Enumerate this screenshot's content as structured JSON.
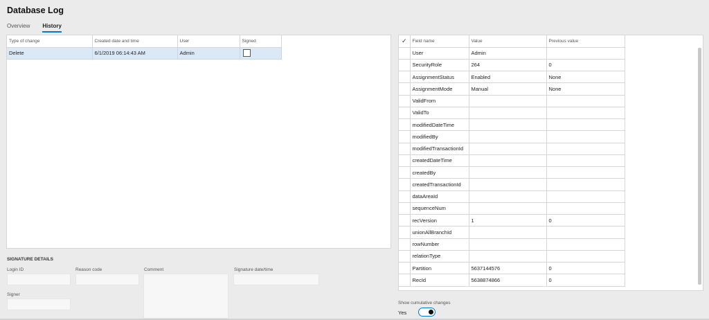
{
  "page": {
    "title": "Database Log"
  },
  "tabs": [
    {
      "label": "Overview",
      "active": false
    },
    {
      "label": "History",
      "active": true
    }
  ],
  "history_grid": {
    "columns": [
      "Type of change",
      "Created date and time",
      "User",
      "Signed"
    ],
    "rows": [
      {
        "type": "Delete",
        "created": "6/1/2019 06:14:43 AM",
        "user": "Admin",
        "signed": false
      }
    ]
  },
  "signature": {
    "title": "SIGNATURE DETAILS",
    "login_id_label": "Login ID",
    "reason_code_label": "Reason code",
    "comment_label": "Comment",
    "signature_datetime_label": "Signature date/time",
    "signer_label": "Signer"
  },
  "field_grid": {
    "check_header": "✓",
    "columns": [
      "Field name",
      "Value",
      "Previous value"
    ],
    "rows": [
      {
        "field": "User",
        "value": "Admin",
        "previous": ""
      },
      {
        "field": "SecurityRole",
        "value": "264",
        "previous": "0"
      },
      {
        "field": "AssignmentStatus",
        "value": "Enabled",
        "previous": "None"
      },
      {
        "field": "AssignmentMode",
        "value": "Manual",
        "previous": "None"
      },
      {
        "field": "ValidFrom",
        "value": "",
        "previous": ""
      },
      {
        "field": "ValidTo",
        "value": "",
        "previous": ""
      },
      {
        "field": "modifiedDateTime",
        "value": "",
        "previous": ""
      },
      {
        "field": "modifiedBy",
        "value": "",
        "previous": ""
      },
      {
        "field": "modifiedTransactionId",
        "value": "",
        "previous": ""
      },
      {
        "field": "createdDateTime",
        "value": "",
        "previous": ""
      },
      {
        "field": "createdBy",
        "value": "",
        "previous": ""
      },
      {
        "field": "createdTransactionId",
        "value": "",
        "previous": ""
      },
      {
        "field": "dataAreaId",
        "value": "",
        "previous": ""
      },
      {
        "field": "sequenceNum",
        "value": "",
        "previous": ""
      },
      {
        "field": "recVersion",
        "value": "1",
        "previous": "0"
      },
      {
        "field": "unionAllBranchId",
        "value": "",
        "previous": ""
      },
      {
        "field": "rowNumber",
        "value": "",
        "previous": ""
      },
      {
        "field": "relationType",
        "value": "",
        "previous": ""
      },
      {
        "field": "Partition",
        "value": "5637144576",
        "previous": "0"
      },
      {
        "field": "RecId",
        "value": "5638874866",
        "previous": "0"
      }
    ]
  },
  "cumulative": {
    "label": "Show cumulative changes",
    "value": "Yes",
    "on": true
  },
  "colors": {
    "accent": "#0078d4",
    "selected_row": "#dbe9f7"
  }
}
